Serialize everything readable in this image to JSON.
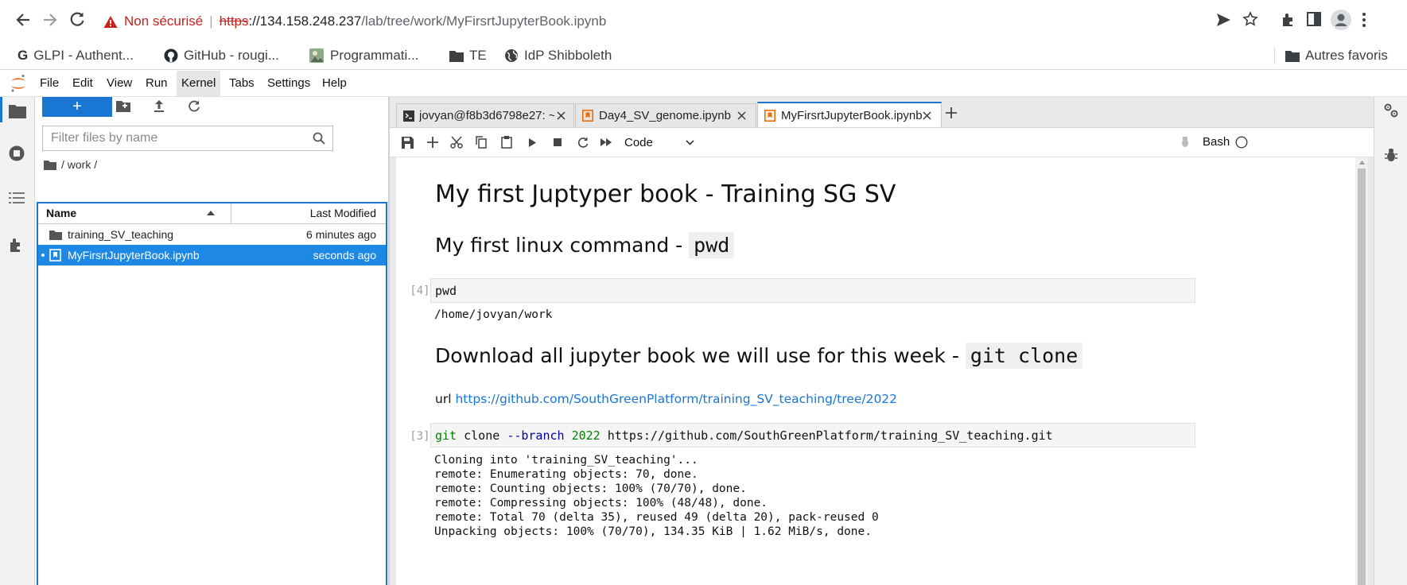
{
  "browser": {
    "security_label": "Non sécurisé",
    "url_scheme": "https",
    "url_rest_host": "://134.158.248.237",
    "url_path": "/lab/tree/work/MyFirsrtJupyterBook.ipynb"
  },
  "bookmarks": {
    "items": [
      "GLPI - Authent...",
      "GitHub - rougi...",
      "Programmati...",
      "TE",
      "IdP Shibboleth"
    ],
    "other": "Autres favoris"
  },
  "menu": {
    "items": [
      "File",
      "Edit",
      "View",
      "Run",
      "Kernel",
      "Tabs",
      "Settings",
      "Help"
    ],
    "active": "Kernel"
  },
  "filebrowser": {
    "new_label": "+",
    "filter_placeholder": "Filter files by name",
    "breadcrumb": "/ work /",
    "col_name": "Name",
    "col_modified": "Last Modified",
    "files": [
      {
        "name": "training_SV_teaching",
        "modified": "6 minutes ago",
        "type": "folder",
        "selected": false
      },
      {
        "name": "MyFirsrtJupyterBook.ipynb",
        "modified": "seconds ago",
        "type": "notebook",
        "selected": true
      }
    ]
  },
  "tabs": [
    {
      "label": "jovyan@f8b3d6798e27: ~/w",
      "type": "terminal"
    },
    {
      "label": "Day4_SV_genome.ipynb",
      "type": "notebook"
    },
    {
      "label": "MyFirsrtJupyterBook.ipynb",
      "type": "notebook"
    }
  ],
  "toolbar": {
    "cell_type": "Code",
    "kernel": "Bash"
  },
  "notebook": {
    "h1": "My first Juptyper book - Training SG SV",
    "h2a_text": "My first linux command - ",
    "h2a_code": "pwd",
    "cell1_prompt": "[4]:",
    "cell1_code": "pwd",
    "cell1_output": "/home/jovyan/work",
    "h2b_text": "Download all jupyter book we will use for this week - ",
    "h2b_code": "git clone",
    "url_label": "url ",
    "url_link": "https://github.com/SouthGreenPlatform/training_SV_teaching/tree/2022",
    "cell2_prompt": "[3]:",
    "cell2_tokens": {
      "cmd": "git",
      "sub": " clone ",
      "flag": "--branch",
      "num": "2022",
      "url": " https://github.com/SouthGreenPlatform/training_SV_teaching.git"
    },
    "cell2_output": [
      "Cloning into 'training_SV_teaching'...",
      "remote: Enumerating objects: 70, done.",
      "remote: Counting objects: 100% (70/70), done.",
      "remote: Compressing objects: 100% (48/48), done.",
      "remote: Total 70 (delta 35), reused 49 (delta 20), pack-reused 0",
      "Unpacking objects: 100% (70/70), 134.35 KiB | 1.62 MiB/s, done."
    ]
  },
  "colors": {
    "accent": "#1976d2",
    "warning": "#c5221f",
    "selected_row": "#1e88e5"
  }
}
